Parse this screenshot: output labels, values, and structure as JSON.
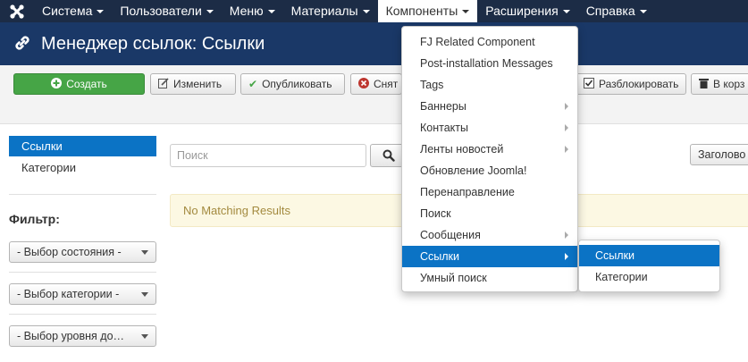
{
  "nav": {
    "items": [
      {
        "label": "Система"
      },
      {
        "label": "Пользователи"
      },
      {
        "label": "Меню"
      },
      {
        "label": "Материалы"
      },
      {
        "label": "Компоненты"
      },
      {
        "label": "Расширения"
      },
      {
        "label": "Справка"
      }
    ]
  },
  "header": {
    "title": "Менеджер ссылок: Ссылки"
  },
  "toolbar": {
    "create": "Создать",
    "edit": "Изменить",
    "publish": "Опубликовать",
    "unpublish": "Снят",
    "unlock": "Разблокировать",
    "trash": "В корз"
  },
  "sidebar": {
    "items": [
      {
        "label": "Ссылки"
      },
      {
        "label": "Категории"
      }
    ],
    "filter_label": "Фильтр:",
    "selects": [
      {
        "value": "- Выбор состояния -"
      },
      {
        "value": "- Выбор категории -"
      },
      {
        "value": "- Выбор уровня до…"
      }
    ]
  },
  "main": {
    "search_placeholder": "Поиск",
    "sort_value": "Заголово",
    "no_results": "No Matching Results"
  },
  "components_menu": {
    "items": [
      {
        "label": "FJ Related Component"
      },
      {
        "label": "Post-installation Messages"
      },
      {
        "label": "Tags"
      },
      {
        "label": "Баннеры"
      },
      {
        "label": "Контакты"
      },
      {
        "label": "Ленты новостей"
      },
      {
        "label": "Обновление Joomla!"
      },
      {
        "label": "Перенаправление"
      },
      {
        "label": "Поиск"
      },
      {
        "label": "Сообщения"
      },
      {
        "label": "Ссылки"
      },
      {
        "label": "Умный поиск"
      }
    ],
    "submenu": [
      {
        "label": "Ссылки"
      },
      {
        "label": "Категории"
      }
    ]
  },
  "colors": {
    "nav_bg": "#1c2c46",
    "title_bg": "#1a3867",
    "accent": "#0b73c5",
    "success": "#46a546"
  }
}
